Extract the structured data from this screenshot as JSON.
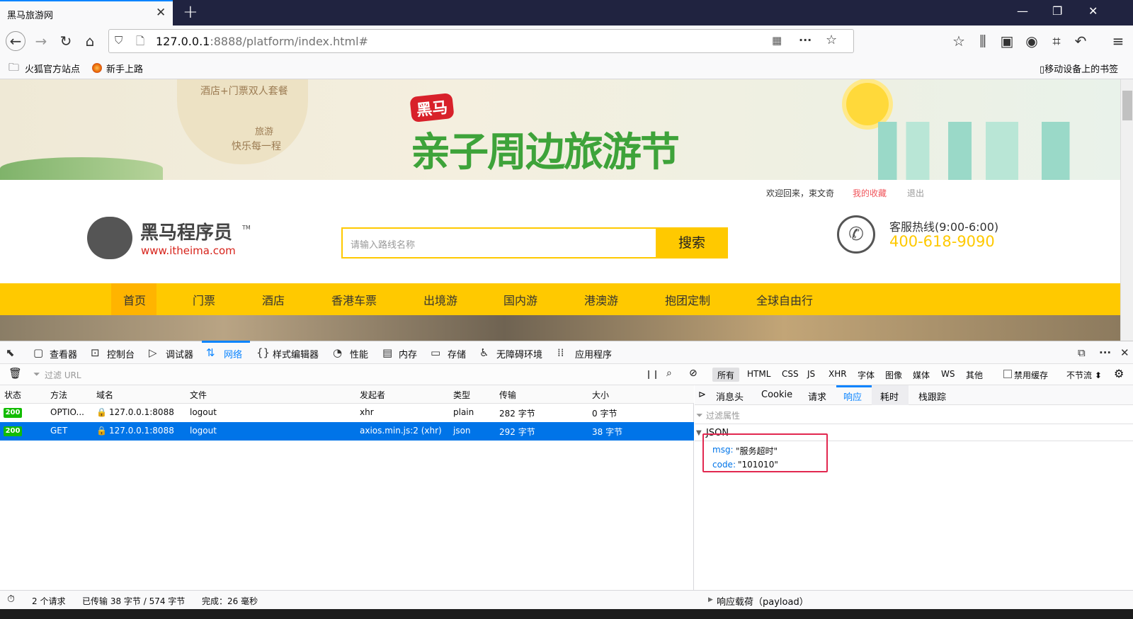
{
  "browser": {
    "tab_title": "黑马旅游网",
    "tab_close": "✕",
    "new_tab": "+",
    "url_host": "127.0.0.1",
    "url_rest": ":8888/platform/index.html#",
    "bookmarks": [
      "火狐官方站点",
      "新手上路"
    ],
    "mobile_bookmarks": "移动设备上的书签"
  },
  "site": {
    "banner_small_1": "酒店+门票双人套餐",
    "banner_small_2": "旅游",
    "banner_small_3": "快乐每一程",
    "banner_badge": "黑马",
    "banner_title": "亲子周边旅游节",
    "welcome": "欢迎回来，束文奇",
    "favorites": "我的收藏",
    "logout": "退出",
    "logo_cn": "黑马程序员",
    "logo_tm": "TM",
    "logo_url": "www.itheima.com",
    "search_placeholder": "请输入路线名称",
    "search_button": "搜索",
    "hotline_label": "客服热线(9:00-6:00)",
    "hotline_number": "400-618-9090",
    "nav": [
      "首页",
      "门票",
      "酒店",
      "香港车票",
      "出境游",
      "国内游",
      "港澳游",
      "抱团定制",
      "全球自由行"
    ]
  },
  "devtools": {
    "tools": [
      "查看器",
      "控制台",
      "调试器",
      "网络",
      "样式编辑器",
      "性能",
      "内存",
      "存储",
      "无障碍环境",
      "应用程序"
    ],
    "filter_placeholder": "过滤 URL",
    "type_filters": [
      "所有",
      "HTML",
      "CSS",
      "JS",
      "XHR",
      "字体",
      "图像",
      "媒体",
      "WS",
      "其他"
    ],
    "disable_cache": "禁用缓存",
    "throttle": "不节流 ⬍",
    "columns": [
      "状态",
      "方法",
      "域名",
      "文件",
      "发起者",
      "类型",
      "传输",
      "大小"
    ],
    "requests": [
      {
        "status": "200",
        "method": "OPTIO...",
        "domain": "127.0.0.1:8088",
        "file": "logout",
        "initiator": "xhr",
        "type": "plain",
        "transfer": "282 字节",
        "size": "0 字节"
      },
      {
        "status": "200",
        "method": "GET",
        "domain": "127.0.0.1:8088",
        "file": "logout",
        "initiator": "axios.min.js:2 (xhr)",
        "type": "json",
        "transfer": "292 字节",
        "size": "38 字节"
      }
    ],
    "detail_tabs": [
      "消息头",
      "Cookie",
      "请求",
      "响应",
      "耗时",
      "栈跟踪"
    ],
    "filter_props": "过滤属性",
    "json_label": "JSON",
    "json_rows": [
      {
        "key": "msg:",
        "value": "\"服务超时\""
      },
      {
        "key": "code:",
        "value": "\"101010\""
      }
    ],
    "payload": "响应载荷（payload）",
    "status_requests": "2 个请求",
    "status_transferred": "已传输 38 字节 / 574 字节",
    "status_finish": "完成：26 毫秒"
  },
  "colors": {
    "accent": "#0a84ff",
    "nav_yellow": "#ffc900",
    "selected_row": "#0074e8",
    "highlight_box": "#e22850"
  }
}
